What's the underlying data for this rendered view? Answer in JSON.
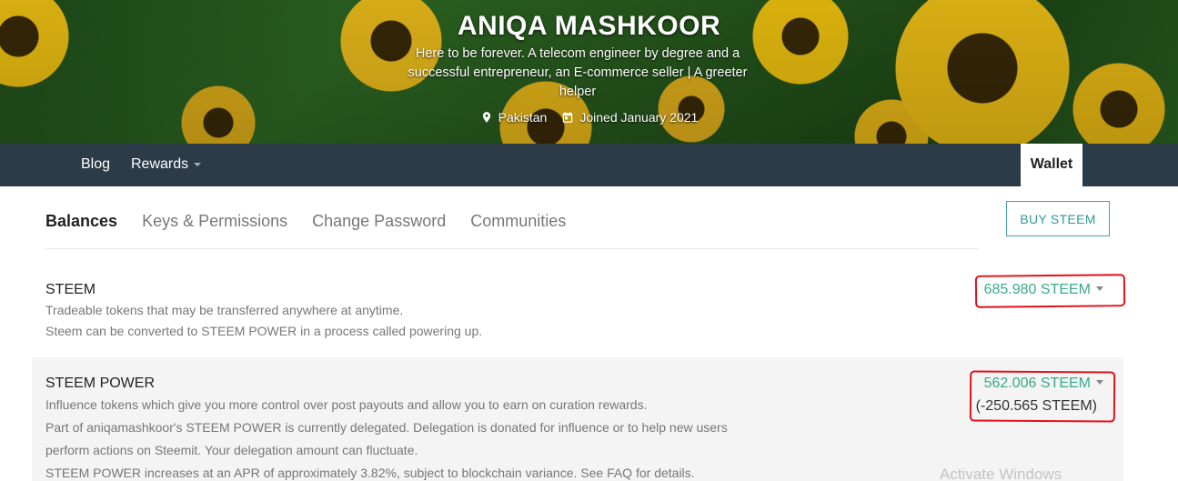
{
  "profile": {
    "name": "ANIQA MASHKOOR",
    "about": "Here to be forever. A telecom engineer by degree and a successful entrepreneur, an E-commerce seller | A greeter helper",
    "location": "Pakistan",
    "joined": "Joined January 2021"
  },
  "nav": {
    "blog": "Blog",
    "rewards": "Rewards",
    "wallet": "Wallet"
  },
  "tabs": [
    {
      "label": "Balances",
      "active": true
    },
    {
      "label": "Keys & Permissions",
      "active": false
    },
    {
      "label": "Change Password",
      "active": false
    },
    {
      "label": "Communities",
      "active": false
    }
  ],
  "buy_button": "BUY STEEM",
  "balances": {
    "steem": {
      "title": "STEEM",
      "desc_1": "Tradeable tokens that may be transferred anywhere at anytime.",
      "desc_2": "Steem can be converted to STEEM POWER in a process called powering up.",
      "amount": "685.980 STEEM"
    },
    "steem_power": {
      "title": "STEEM POWER",
      "desc_1": "Influence tokens which give you more control over post payouts and allow you to earn on curation rewards.",
      "desc_2": "Part of aniqamashkoor's STEEM POWER is currently delegated. Delegation is donated for influence or to help new users perform actions on Steemit. Your delegation amount can fluctuate.",
      "desc_3": "STEEM POWER increases at an APR of approximately 3.82%, subject to blockchain variance. See FAQ for details.",
      "amount": "562.006 STEEM",
      "delegated": "(-250.565 STEEM)"
    }
  },
  "watermark": "Activate Windows",
  "colors": {
    "nav_bg": "#2c3b48",
    "accent_green": "#3aaa8c",
    "annotation_red": "#e3101c"
  }
}
